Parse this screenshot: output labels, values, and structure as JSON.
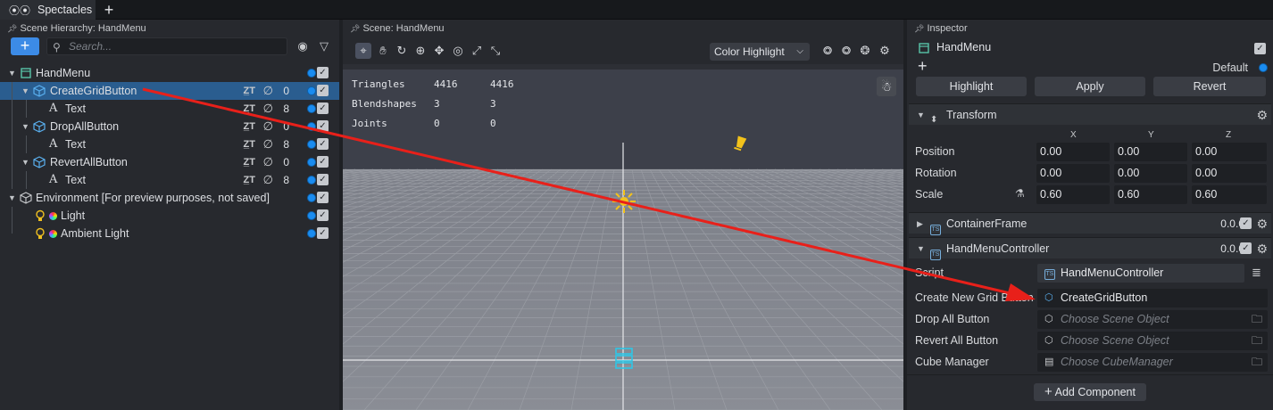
{
  "app": {
    "tab_label": "Spectacles",
    "new_tab_label": "+"
  },
  "hierarchy": {
    "title": "Scene Hierarchy: HandMenu",
    "add_label": "+",
    "search_placeholder": "Search...",
    "items": [
      {
        "label": "HandMenu",
        "icon": "scene-object-icon",
        "expanded": true,
        "layer": "",
        "selected": false
      },
      {
        "label": "CreateGridButton",
        "icon": "cube-icon",
        "expanded": true,
        "layer": "0",
        "selected": true
      },
      {
        "label": "Text",
        "icon": "text-icon",
        "layer": "8"
      },
      {
        "label": "DropAllButton",
        "icon": "cube-icon",
        "expanded": true,
        "layer": "0"
      },
      {
        "label": "Text",
        "icon": "text-icon",
        "layer": "8"
      },
      {
        "label": "RevertAllButton",
        "icon": "cube-icon",
        "expanded": true,
        "layer": "0"
      },
      {
        "label": "Text",
        "icon": "text-icon",
        "layer": "8"
      },
      {
        "label": "Environment [For preview purposes, not saved]",
        "icon": "environment-icon",
        "expanded": true,
        "layer": ""
      },
      {
        "label": "Light",
        "icon": "light-icon",
        "layer": ""
      },
      {
        "label": "Ambient Light",
        "icon": "light-icon",
        "layer": ""
      }
    ]
  },
  "scene": {
    "title": "Scene: HandMenu",
    "shading_mode": "Color Highlight",
    "stats": [
      {
        "name": "Triangles",
        "a": "4416",
        "b": "4416"
      },
      {
        "name": "Blendshapes",
        "a": "3",
        "b": "3"
      },
      {
        "name": "Joints",
        "a": "0",
        "b": "0"
      }
    ]
  },
  "inspector": {
    "title": "Inspector",
    "object_name": "HandMenu",
    "default_label": "Default",
    "buttons": {
      "highlight": "Highlight",
      "apply": "Apply",
      "revert": "Revert"
    },
    "transform": {
      "title": "Transform",
      "axes": [
        "X",
        "Y",
        "Z"
      ],
      "rows": [
        {
          "label": "Position",
          "values": [
            "0.00",
            "0.00",
            "0.00"
          ]
        },
        {
          "label": "Rotation",
          "values": [
            "0.00",
            "0.00",
            "0.00"
          ]
        },
        {
          "label": "Scale",
          "values": [
            "0.60",
            "0.60",
            "0.60"
          ]
        }
      ]
    },
    "container_frame": {
      "title": "ContainerFrame",
      "version": "0.0.0"
    },
    "controller": {
      "title": "HandMenuController",
      "version": "0.0.0",
      "script_label": "Script",
      "script_value": "HandMenuController",
      "fields": [
        {
          "label": "Create New Grid Button",
          "value": "CreateGridButton",
          "empty": false
        },
        {
          "label": "Drop All Button",
          "value": "Choose Scene Object",
          "empty": true
        },
        {
          "label": "Revert All Button",
          "value": "Choose Scene Object",
          "empty": true
        },
        {
          "label": "Cube Manager",
          "value": "Choose CubeManager",
          "empty": true
        }
      ]
    },
    "add_component": "Add Component"
  },
  "colors": {
    "accent": "#3c8be6",
    "selection": "#2a5d8f",
    "annotation_arrow": "#e8201a"
  }
}
